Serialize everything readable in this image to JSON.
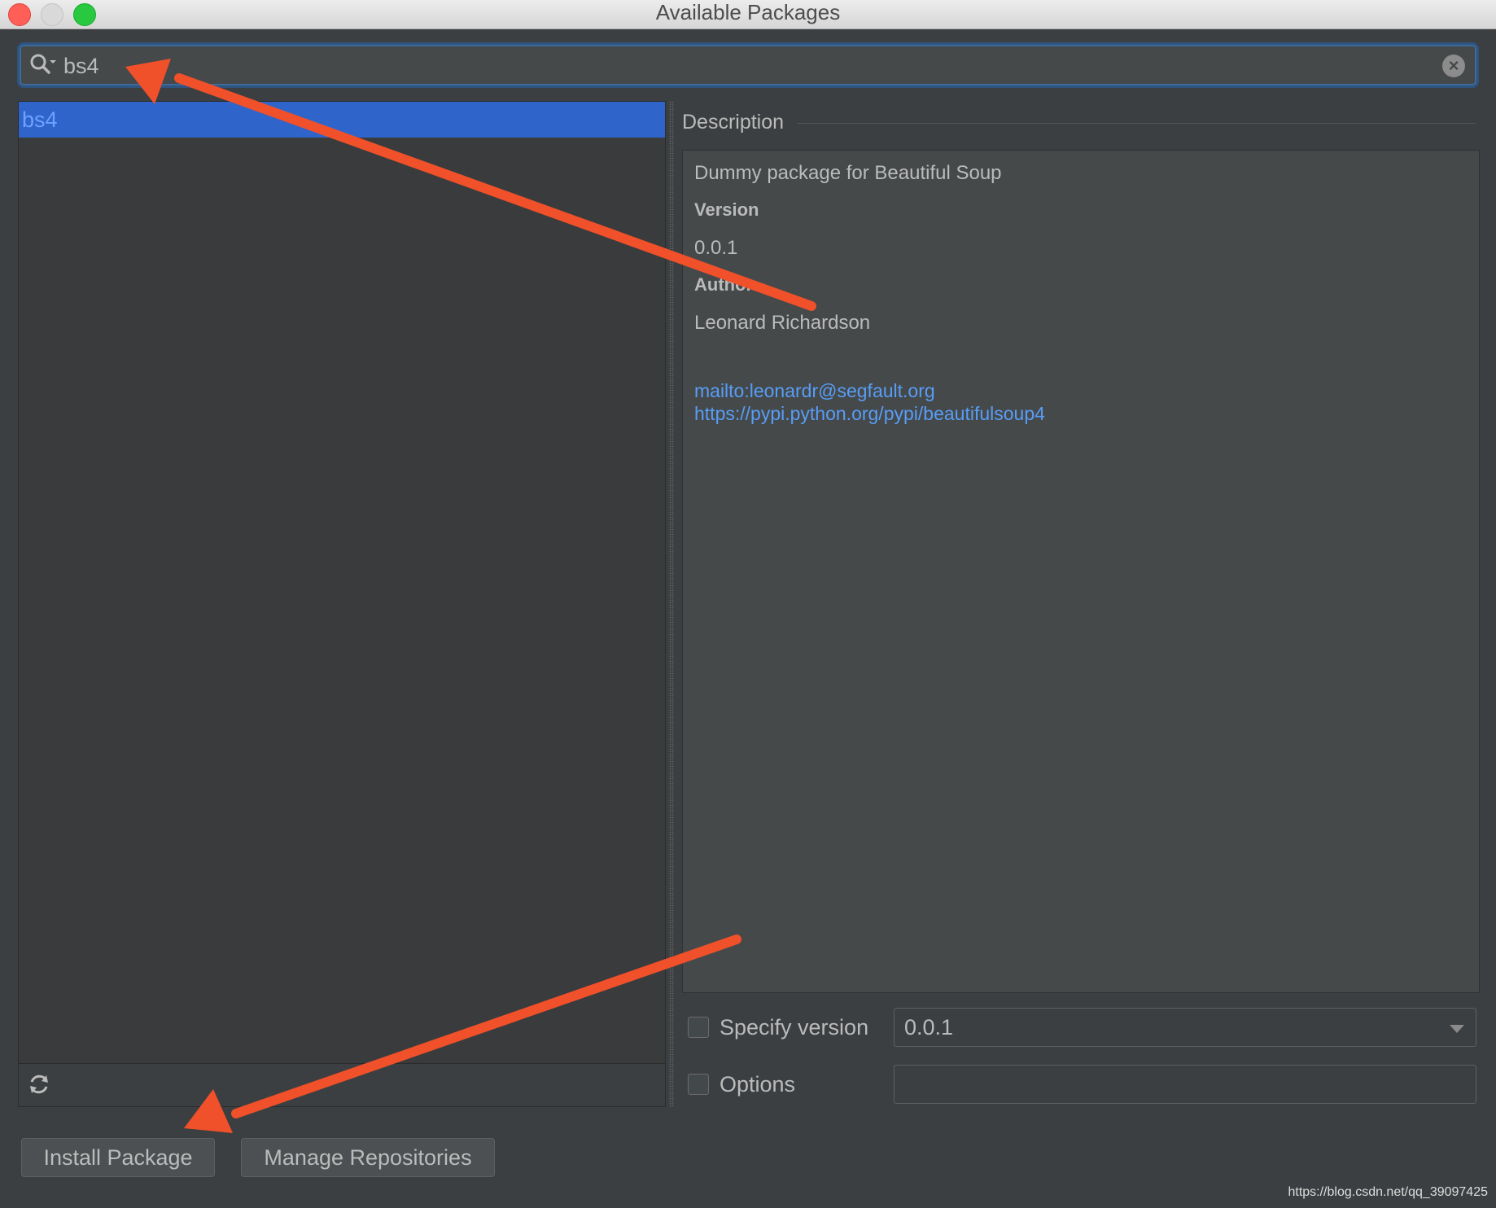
{
  "window": {
    "title": "Available Packages"
  },
  "search": {
    "value": "bs4"
  },
  "packages": [
    {
      "name": "bs4"
    }
  ],
  "description": {
    "header": "Description",
    "summary": "Dummy package for Beautiful Soup",
    "version_label": "Version",
    "version_value": "0.0.1",
    "author_label": "Author",
    "author_value": "Leonard Richardson",
    "link_email": "mailto:leonardr@segfault.org",
    "link_homepage": "https://pypi.python.org/pypi/beautifulsoup4"
  },
  "specify_version": {
    "label": "Specify version",
    "checked": false,
    "selected": "0.0.1"
  },
  "options": {
    "label": "Options",
    "checked": false,
    "value": ""
  },
  "buttons": {
    "install": "Install Package",
    "manage": "Manage Repositories"
  },
  "watermark": "https://blog.csdn.net/qq_39097425",
  "colors": {
    "selection": "#2f65ca",
    "link": "#589df6",
    "annotation_arrow": "#f0502a"
  }
}
